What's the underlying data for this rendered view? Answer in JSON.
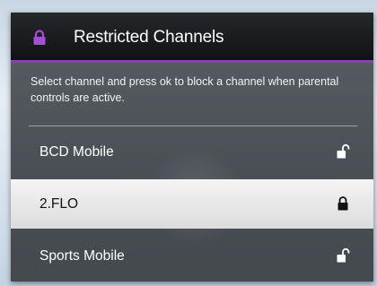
{
  "header": {
    "icon": "lock-icon",
    "title": "Restricted Channels",
    "accent_color": "#8a3fb8"
  },
  "instructions": "Select channel and press ok to block a channel when parental controls are active.",
  "channels": [
    {
      "name": "BCD Mobile",
      "locked": false,
      "selected": false,
      "icon": "unlocked-icon"
    },
    {
      "name": "2.FLO",
      "locked": true,
      "selected": true,
      "icon": "lock-icon"
    },
    {
      "name": "Sports Mobile",
      "locked": false,
      "selected": false,
      "icon": "unlocked-icon"
    }
  ]
}
